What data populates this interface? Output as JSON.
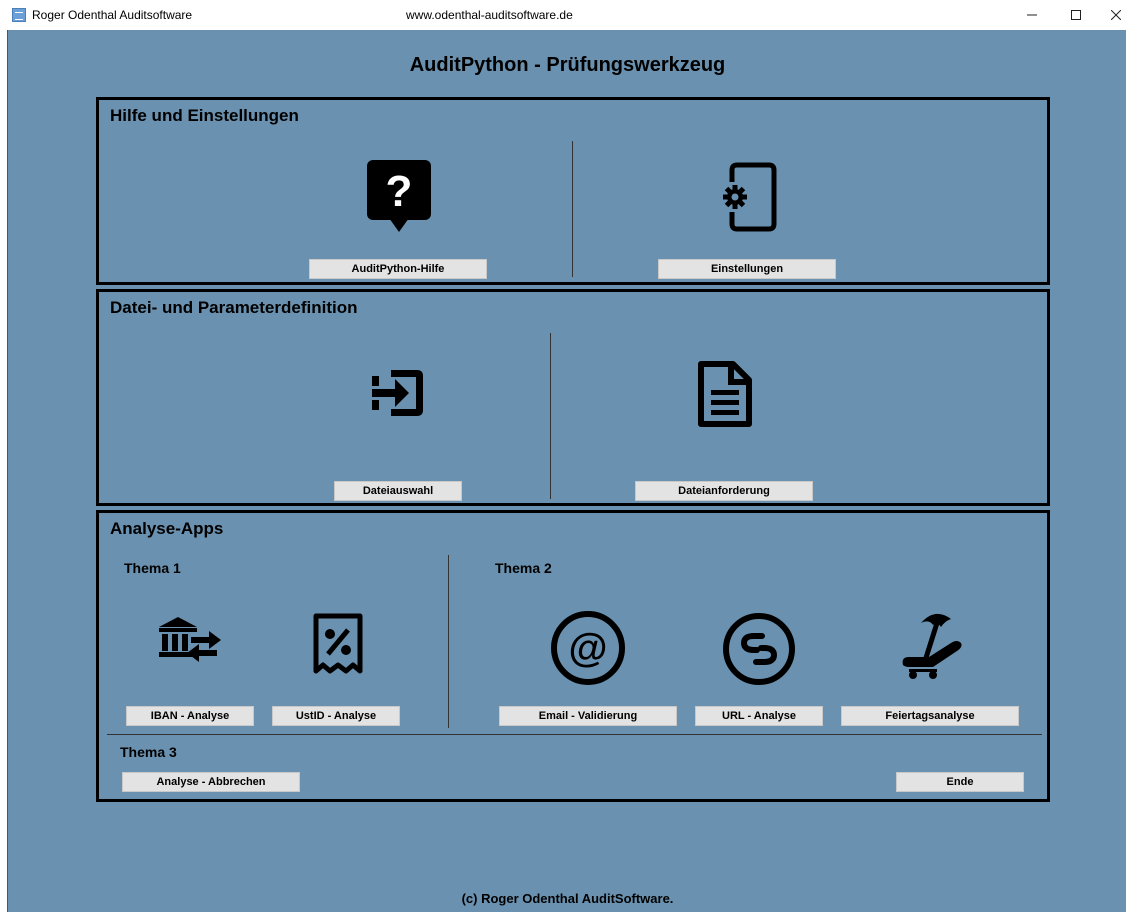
{
  "window": {
    "title": "Roger Odenthal Auditsoftware",
    "url": "www.odenthal-auditsoftware.de",
    "minimize_label": "–",
    "maximize_label": "☐",
    "close_label": "✕"
  },
  "app": {
    "title": "AuditPython - Prüfungswerkzeug",
    "footer": "(c) Roger Odenthal AuditSoftware."
  },
  "help_panel": {
    "title": "Hilfe und Einstellungen",
    "help_button": "AuditPython-Hilfe",
    "settings_button": "Einstellungen"
  },
  "file_panel": {
    "title": "Datei- und Parameterdefinition",
    "select_button": "Dateiauswahl",
    "request_button": "Dateianforderung"
  },
  "analysis_panel": {
    "title": "Analyse-Apps",
    "thema1": "Thema 1",
    "thema2": "Thema 2",
    "thema3": "Thema 3",
    "iban_button": "IBAN - Analyse",
    "ustid_button": "UstID - Analyse",
    "email_button": "Email - Validierung",
    "url_button": "URL - Analyse",
    "holiday_button": "Feiertagsanalyse",
    "cancel_button": "Analyse - Abbrechen",
    "end_button": "Ende"
  },
  "icons": {
    "help": "question-speech-icon",
    "settings": "phone-settings-icon",
    "file_select": "login-arrow-icon",
    "file_request": "document-icon",
    "iban": "bank-transfer-icon",
    "ustid": "percent-receipt-icon",
    "email": "at-sign-icon",
    "url": "link-circle-icon",
    "holiday": "beach-chair-icon"
  },
  "colors": {
    "background": "#6a92b0",
    "panel_border": "#000000",
    "button": "#e3e3e3"
  }
}
